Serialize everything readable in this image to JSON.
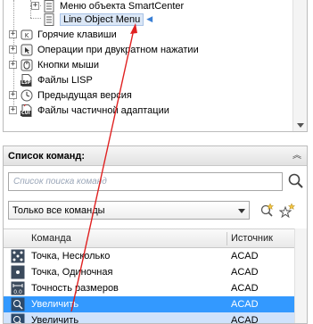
{
  "tree": {
    "items": [
      {
        "label": "Меню объекта SmartCenter",
        "icon": "menu-icon"
      },
      {
        "label": "Line Object Menu",
        "icon": "menu-icon",
        "selected": true
      },
      {
        "label": "Горячие клавиши",
        "icon": "hotkeys-icon"
      },
      {
        "label": "Операции при двукратном нажатии",
        "icon": "double-click-icon"
      },
      {
        "label": "Кнопки мыши",
        "icon": "mouse-buttons-icon"
      },
      {
        "label": "Файлы LISP",
        "icon": "lisp-file-icon"
      },
      {
        "label": "Предыдущая версия",
        "icon": "legacy-icon"
      },
      {
        "label": "Файлы частичной адаптации",
        "icon": "partial-cui-icon"
      }
    ],
    "lisp_badge": "LSP",
    "cui_badge": "CUI"
  },
  "command_list": {
    "title": "Список команд:",
    "search_placeholder": "Список поиска команд",
    "filter_value": "Только все команды",
    "columns": {
      "command": "Команда",
      "source": "Источник"
    },
    "rows": [
      {
        "name": "Точка, Несколько",
        "source": "ACAD",
        "icon": "multiple-points-icon"
      },
      {
        "name": "Точка, Одиночная",
        "source": "ACAD",
        "icon": "single-point-icon"
      },
      {
        "name": "Точность размеров",
        "source": "ACAD",
        "icon": "dimension-precision-icon"
      },
      {
        "name": "Увеличить",
        "source": "ACAD",
        "icon": "zoom-in-icon",
        "state": "selected"
      },
      {
        "name": "Увеличить",
        "source": "ACAD",
        "icon": "zoom-in-icon",
        "state": "highlight"
      }
    ]
  },
  "colors": {
    "selection": "#3399ff",
    "arrow": "#e02020",
    "marker": "#3a7fd5"
  }
}
